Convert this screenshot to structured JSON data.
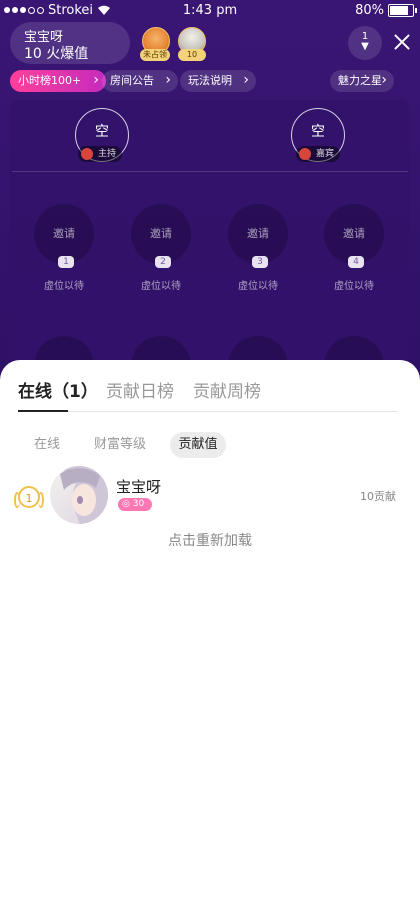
{
  "status_bar": {
    "carrier": "Strokei",
    "time": "1:43 pm",
    "battery": "80%"
  },
  "room": {
    "name": "宝宝呀",
    "heat": "10 火爆值"
  },
  "header_avatars": [
    {
      "tag": "未占领"
    },
    {
      "tag": "10"
    }
  ],
  "online_count": "1",
  "chips": {
    "hourly_rank": "小时榜100+",
    "announcement": "房间公告",
    "rules": "玩法说明",
    "charm_star": "魅力之星"
  },
  "host_seats": [
    {
      "label": "空",
      "role": "主持"
    },
    {
      "label": "空",
      "role": "嘉宾"
    }
  ],
  "mics": [
    {
      "label": "邀请",
      "num": "1",
      "status": "虚位以待"
    },
    {
      "label": "邀请",
      "num": "2",
      "status": "虚位以待"
    },
    {
      "label": "邀请",
      "num": "3",
      "status": "虚位以待"
    },
    {
      "label": "邀请",
      "num": "4",
      "status": "虚位以待"
    }
  ],
  "sheet": {
    "main_tabs": [
      "在线（1）",
      "贡献日榜",
      "贡献周榜"
    ],
    "sub_tabs": [
      "在线",
      "财富等级",
      "贡献值"
    ],
    "user": {
      "rank": "1",
      "name": "宝宝呀",
      "level": "30",
      "contribution": "10贡献"
    },
    "reload": "点击重新加载"
  }
}
